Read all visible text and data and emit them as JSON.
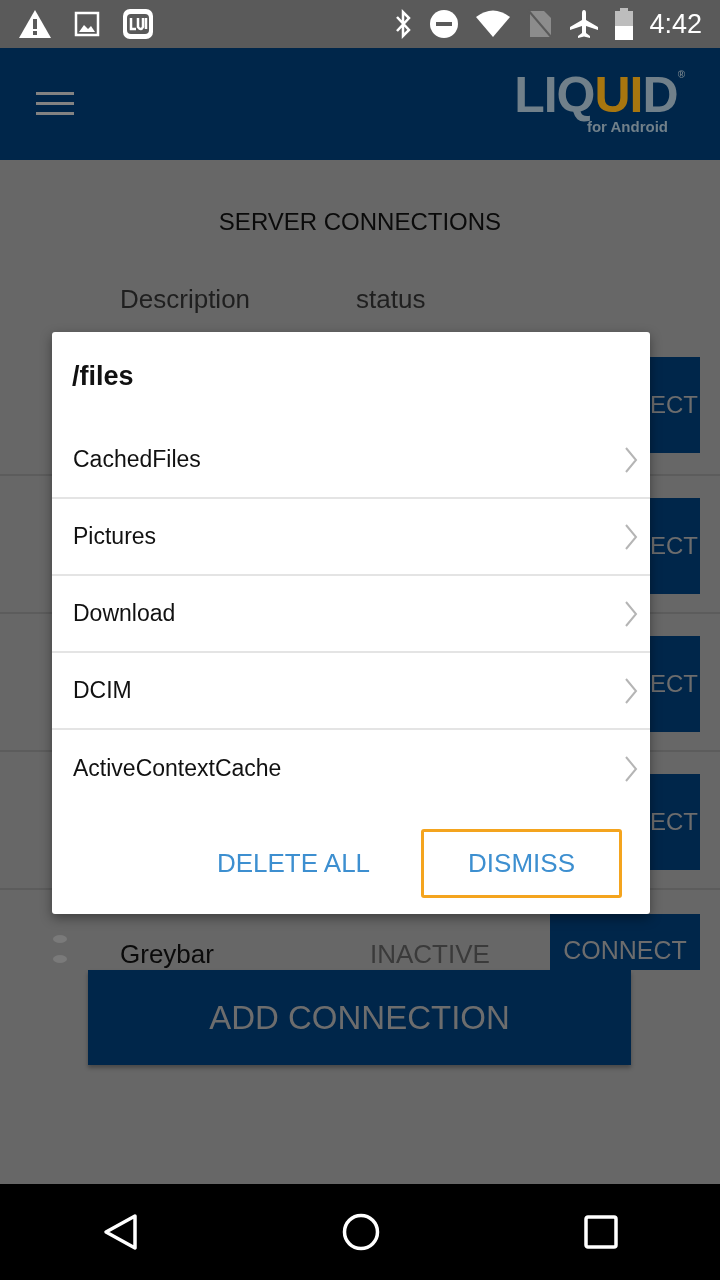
{
  "status_bar": {
    "time": "4:42"
  },
  "app_bar": {
    "logo": {
      "parts": [
        {
          "text": "LIQ",
          "color": "#71808a"
        },
        {
          "text": "UI",
          "color": "#a8760f"
        },
        {
          "text": "D",
          "color": "#71808a"
        }
      ],
      "mark": "®",
      "subtitle": "for Android"
    }
  },
  "screen": {
    "title": "SERVER CONNECTIONS",
    "columns": [
      "Description",
      "status"
    ],
    "rows": [
      {
        "button": "ECT"
      },
      {
        "button": "ECT"
      },
      {
        "button": "ECT"
      },
      {
        "button": "ECT"
      }
    ],
    "last_row": {
      "name": "Greybar",
      "status": "INACTIVE",
      "button": "CONNECT"
    },
    "add_button": "ADD CONNECTION"
  },
  "dialog": {
    "title": "/files",
    "items": [
      {
        "label": "CachedFiles"
      },
      {
        "label": "Pictures"
      },
      {
        "label": "Download"
      },
      {
        "label": "DCIM"
      },
      {
        "label": "ActiveContextCache"
      }
    ],
    "buttons": [
      {
        "label": "DELETE ALL",
        "focused": false
      },
      {
        "label": "DISMISS",
        "focused": true
      }
    ]
  }
}
